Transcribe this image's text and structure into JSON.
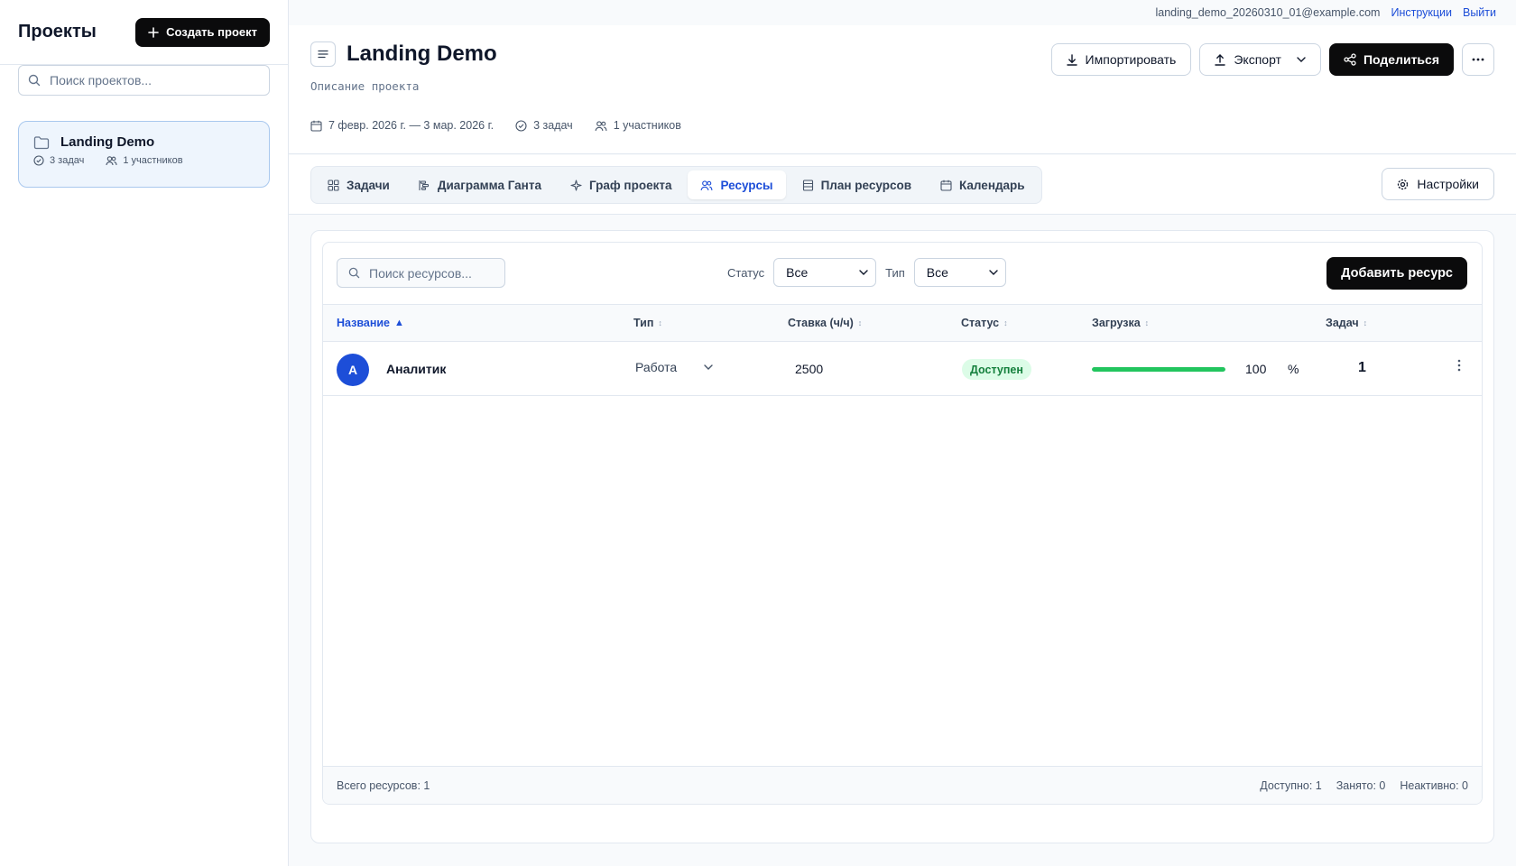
{
  "sidebar": {
    "title": "Проекты",
    "create_button": "Создать проект",
    "search_placeholder": "Поиск проектов...",
    "projects": [
      {
        "name": "Landing Demo",
        "tasks": "3 задач",
        "members": "1 участников"
      }
    ]
  },
  "topbar": {
    "email": "landing_demo_20260310_01@example.com",
    "instructions": "Инструкции",
    "logout": "Выйти"
  },
  "project": {
    "title": "Landing Demo",
    "description": "Описание проекта",
    "dates": "7 февр. 2026 г. — 3 мар. 2026 г.",
    "tasks": "3 задач",
    "members": "1 участников",
    "actions": {
      "import": "Импортировать",
      "export": "Экспорт",
      "share": "Поделиться"
    }
  },
  "tabs": [
    {
      "label": "Задачи",
      "icon": "grid-icon",
      "active": false
    },
    {
      "label": "Диаграмма Ганта",
      "icon": "gantt-icon",
      "active": false
    },
    {
      "label": "Граф проекта",
      "icon": "graph-icon",
      "active": false
    },
    {
      "label": "Ресурсы",
      "icon": "users-icon",
      "active": true
    },
    {
      "label": "План ресурсов",
      "icon": "plan-icon",
      "active": false
    },
    {
      "label": "Календарь",
      "icon": "calendar-icon",
      "active": false
    }
  ],
  "settings_button": "Настройки",
  "resources": {
    "search_placeholder": "Поиск ресурсов...",
    "filter_status_label": "Статус",
    "filter_status_value": "Все",
    "filter_type_label": "Тип",
    "filter_type_value": "Все",
    "add_button": "Добавить ресурс",
    "columns": [
      "Название",
      "Тип",
      "Ставка (ч/ч)",
      "Статус",
      "Загрузка",
      "Задач"
    ],
    "sorted_column": "Название",
    "sort_indicator": "▲",
    "rows": [
      {
        "initial": "А",
        "name": "Аналитик",
        "type": "Работа",
        "rate": "2500",
        "status": "Доступен",
        "load": "100",
        "load_unit": "%",
        "load_fraction": 1.0,
        "tasks": "1"
      }
    ],
    "footer": {
      "total": "Всего ресурсов: 1",
      "available": "Доступно: 1",
      "busy": "Занято: 0",
      "inactive": "Неактивно: 0"
    }
  },
  "colors": {
    "accent": "#1d4ed8",
    "primary_button": "#0b0b0c",
    "status_available_bg": "#dcfce7",
    "status_available_text": "#15803d",
    "load_bar": "#22c55e"
  }
}
